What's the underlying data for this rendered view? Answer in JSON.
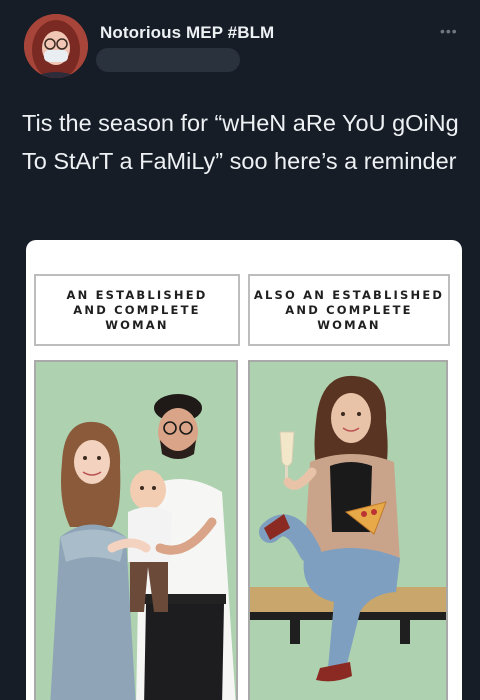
{
  "tweet": {
    "display_name": "Notorious MEP #BLM",
    "text": "Tis the season for “wHeN aRe YoU gOiNg To StArT a FaMiLy” soo here’s a reminder"
  },
  "comic": {
    "left_caption": "AN ESTABLISHED\nAND COMPLETE\nWOMAN",
    "right_caption": "ALSO AN ESTABLISHED\nAND COMPLETE\nWOMAN"
  },
  "icons": {
    "more": "more-options-icon",
    "avatar": "profile-avatar"
  },
  "colors": {
    "background": "#161d27",
    "panel_green": "#aed1b0",
    "text": "#eef1f4"
  }
}
